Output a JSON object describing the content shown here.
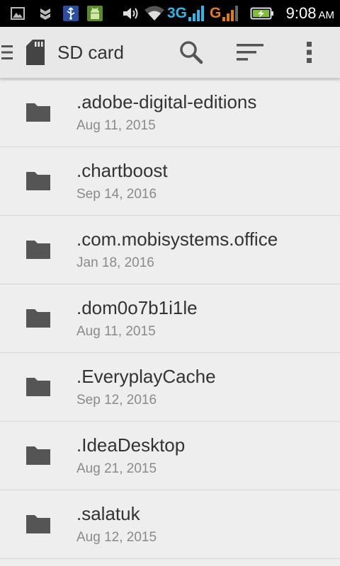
{
  "status_bar": {
    "network_3g": "3G",
    "network_g": "G",
    "time": "9:08",
    "ampm": "AM",
    "icons": [
      "image-icon",
      "shield-icon",
      "usb-icon",
      "android-icon",
      "volume-icon",
      "wifi-icon",
      "signal-icon",
      "battery-charging-icon"
    ]
  },
  "toolbar": {
    "title": "SD card",
    "icons": [
      "menu-icon",
      "sd-card-icon",
      "search-icon",
      "sort-icon",
      "overflow-menu-icon"
    ]
  },
  "files": [
    {
      "name": ".adobe-digital-editions",
      "date": "Aug 11, 2015"
    },
    {
      "name": ".chartboost",
      "date": "Sep 14, 2016"
    },
    {
      "name": ".com.mobisystems.office",
      "date": "Jan 18, 2016"
    },
    {
      "name": ".dom0o7b1i1le",
      "date": "Aug 11, 2015"
    },
    {
      "name": ".EveryplayCache",
      "date": "Sep 12, 2016"
    },
    {
      "name": ".IdeaDesktop",
      "date": "Aug 21, 2015"
    },
    {
      "name": ".salatuk",
      "date": "Aug 12, 2015"
    }
  ],
  "colors": {
    "status_blue": "#33b5e5",
    "status_orange": "#e07b1a",
    "folder": "#555555"
  }
}
